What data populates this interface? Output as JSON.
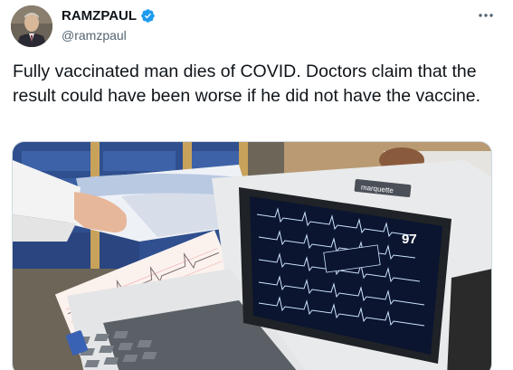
{
  "author": {
    "display_name": "RAMZPAUL",
    "handle": "@ramzpaul",
    "verified": true,
    "avatar_icon": "avatar-photo"
  },
  "tweet": {
    "text": "Fully vaccinated man dies of COVID. Doctors claim that the result could have been worse if he did not have the vaccine."
  },
  "media": {
    "monitor_brand": "marquette",
    "monitor_reading": "97"
  },
  "colors": {
    "text": "#0f1419",
    "secondary": "#536471",
    "verified": "#1d9bf0"
  },
  "icons": {
    "verified": "verified-badge-icon",
    "more": "more-options-icon"
  }
}
